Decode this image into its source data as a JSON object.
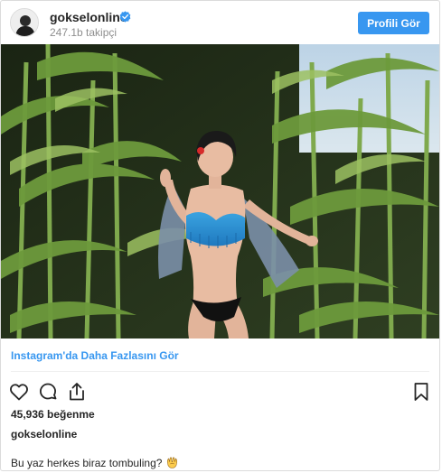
{
  "header": {
    "username": "gokselonline",
    "followers": "247.1b takipçi",
    "profile_button": "Profili Gör",
    "verified_icon": "verified-badge-icon"
  },
  "post": {
    "image_alt": "photo",
    "more_link": "Instagram'da Daha Fazlasını Gör",
    "likes": "45,936 beğenme",
    "caption_user": "gokselonline",
    "caption_text": "Bu yaz herkes biraz tombuling?",
    "caption_emoji": "raised-hands-emoji"
  },
  "actions": {
    "like_icon": "heart-icon",
    "comment_icon": "comment-icon",
    "share_icon": "share-icon",
    "save_icon": "bookmark-icon"
  },
  "colors": {
    "accent": "#3897f0",
    "text": "#262626",
    "muted": "#8e8e8e",
    "border": "#dbdbdb"
  }
}
